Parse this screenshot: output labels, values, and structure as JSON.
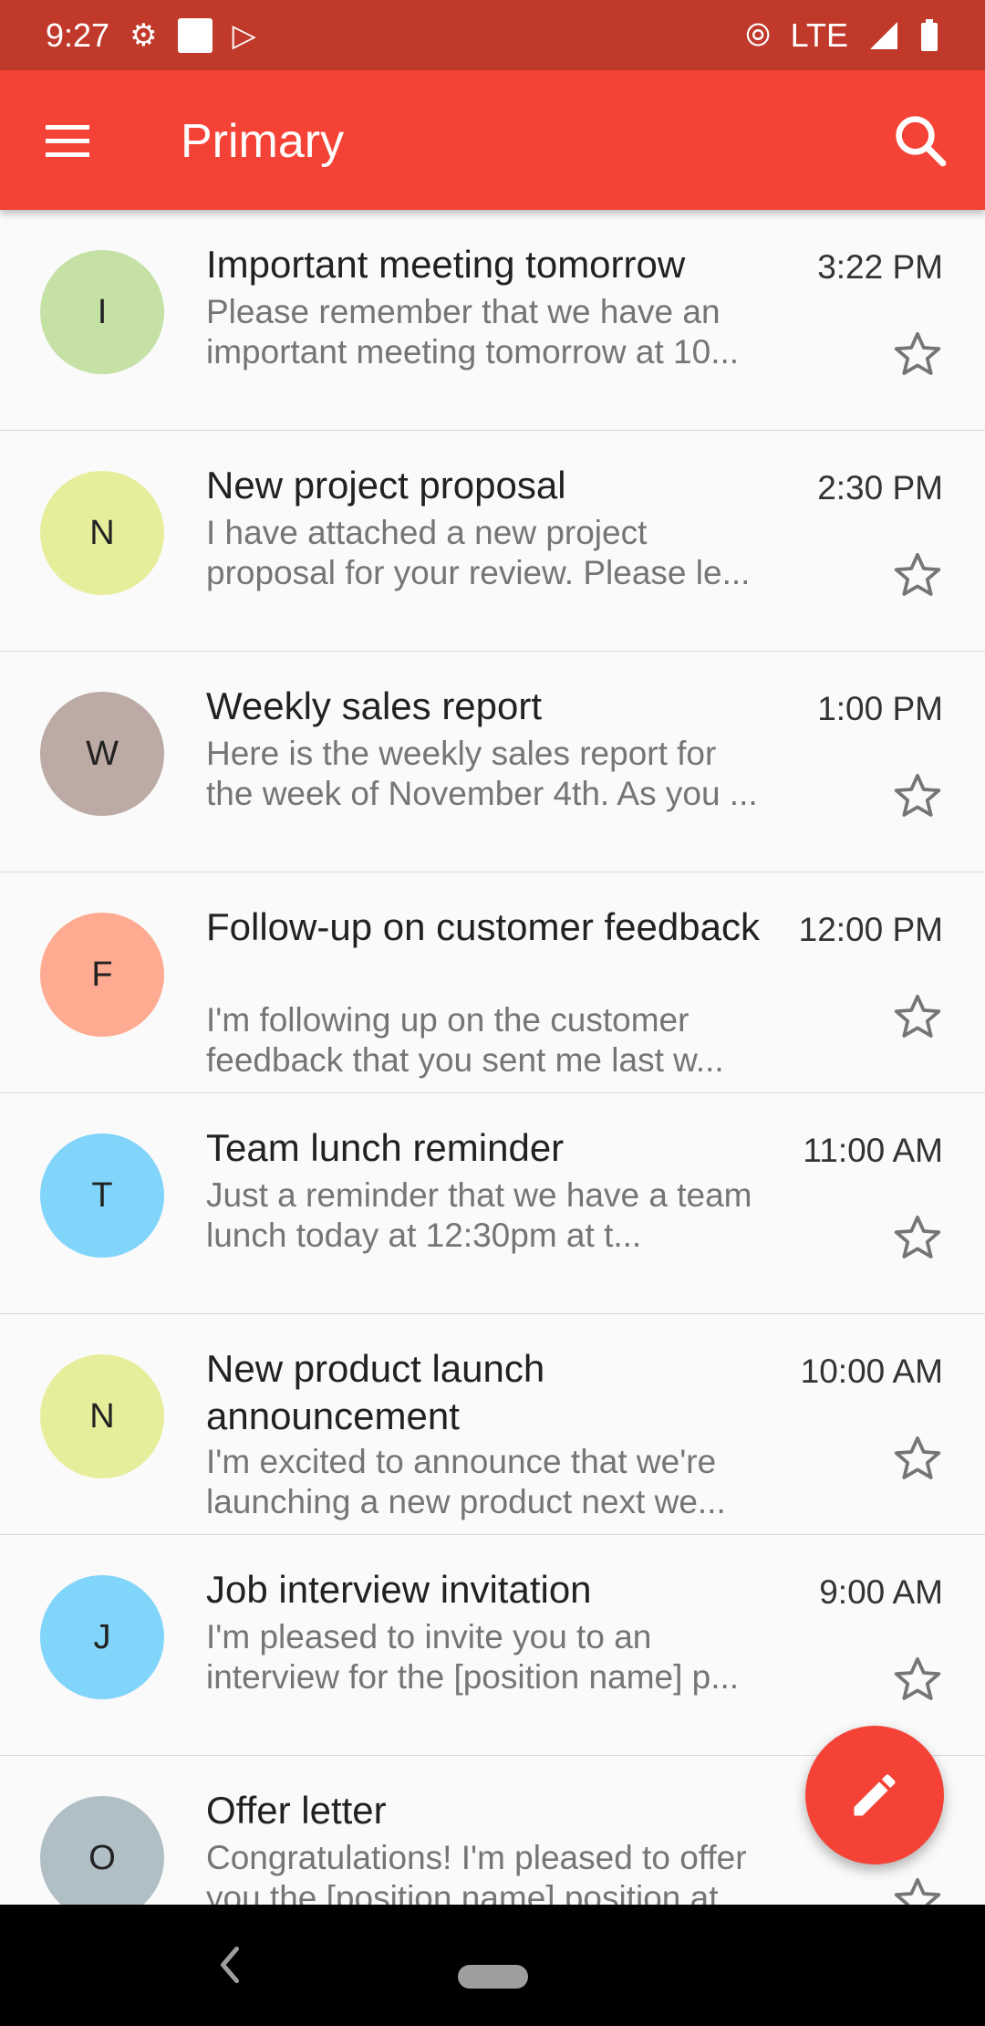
{
  "status_bar": {
    "time": "9:27",
    "network": "LTE"
  },
  "app_bar": {
    "title": "Primary",
    "menu_icon": "hamburger-menu-icon",
    "search_icon": "search-icon"
  },
  "emails": [
    {
      "initial": "I",
      "avatar_color": "#c5e1a5",
      "subject": "Important meeting tomorrow",
      "preview": "Please remember that we have an important meeting tomorrow at 10...",
      "time": "3:22 PM"
    },
    {
      "initial": "N",
      "avatar_color": "#e6ee9c",
      "subject": "New project proposal",
      "preview": "I have attached a new project proposal for your review. Please le...",
      "time": "2:30 PM"
    },
    {
      "initial": "W",
      "avatar_color": "#bcaaa4",
      "subject": "Weekly sales report",
      "preview": "Here is the weekly sales report for the week of November 4th. As you ...",
      "time": "1:00 PM"
    },
    {
      "initial": "F",
      "avatar_color": "#ffab91",
      "subject": "Follow-up on customer feedback",
      "preview": "I'm following up on the customer feedback that you sent me last w...",
      "time": "12:00 PM"
    },
    {
      "initial": "T",
      "avatar_color": "#81d4fa",
      "subject": "Team lunch reminder",
      "preview": "Just a reminder that we have a team lunch today at 12:30pm at t...",
      "time": "11:00 AM"
    },
    {
      "initial": "N",
      "avatar_color": "#e6ee9c",
      "subject": "New product launch announcement",
      "preview": "I'm excited to announce that we're launching a new product next we...",
      "time": "10:00 AM"
    },
    {
      "initial": "J",
      "avatar_color": "#81d4fa",
      "subject": "Job interview invitation",
      "preview": "I'm pleased to invite you to an interview for the [position name] p...",
      "time": "9:00 AM"
    },
    {
      "initial": "O",
      "avatar_color": "#b0bec5",
      "subject": "Offer letter",
      "preview": "Congratulations! I'm pleased to offer you the [position name] position at...",
      "time": ""
    }
  ],
  "fab": {
    "icon": "pencil-edit-icon"
  },
  "colors": {
    "accent": "#f44336",
    "status_bar": "#c0392b"
  }
}
